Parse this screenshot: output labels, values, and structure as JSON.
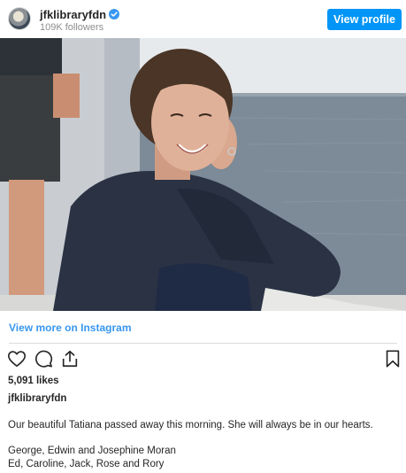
{
  "post": {
    "username": "jfklibraryfdn",
    "followers": "109K followers",
    "view_profile_label": "View profile",
    "view_more_label": "View more on Instagram",
    "likes": "5,091 likes",
    "caption_username": "jfklibraryfdn",
    "caption_text": "Our beautiful Tatiana passed away this morning. She will always be in our hearts.",
    "signature_line_1": "George, Edwin and Josephine Moran",
    "signature_line_2": "Ed, Caroline, Jack, Rose and Rory"
  },
  "icons": {
    "verified": "verified-badge-icon",
    "like": "heart-icon",
    "comment": "comment-icon",
    "share": "share-icon",
    "save": "bookmark-icon"
  },
  "colors": {
    "accent": "#0095f6",
    "link": "#3897f0",
    "muted": "#8e8e8e",
    "text": "#262626"
  }
}
